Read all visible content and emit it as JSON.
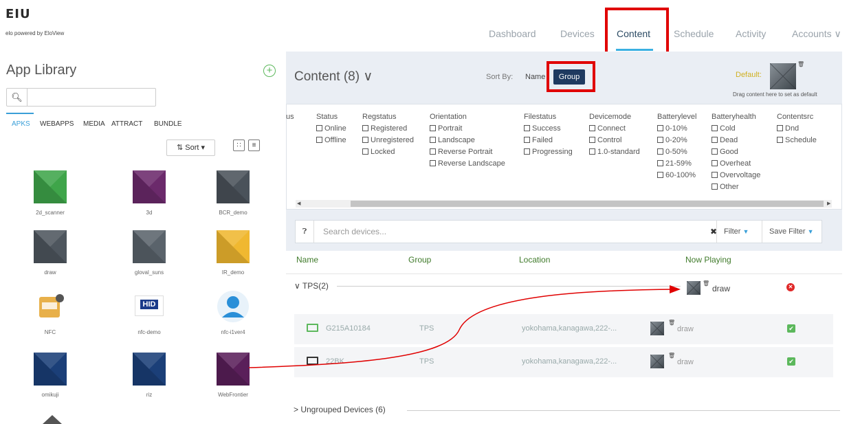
{
  "header": {
    "logo": "EIU",
    "powered_by": "elo powered by EloView",
    "nav": [
      "Dashboard",
      "Devices",
      "Content",
      "Schedule",
      "Activity",
      "Accounts ∨"
    ]
  },
  "library": {
    "title": "App Library",
    "search_placeholder": "",
    "tabs": [
      "APKS",
      "WEBAPPS",
      "MEDIA",
      "ATTRACT",
      "BUNDLE"
    ],
    "sort_label": "Sort",
    "apps": [
      {
        "name": "2d_scanner",
        "color": "#3fa54a"
      },
      {
        "name": "3d",
        "color": "#6b2a6b"
      },
      {
        "name": "BCR_demo",
        "color": "#4a525a"
      },
      {
        "name": "draw",
        "color": "#4e565e"
      },
      {
        "name": "gloval_suns",
        "color": "#5a636b"
      },
      {
        "name": "IR_demo",
        "color": "#f0b830"
      },
      {
        "name": "NFC",
        "color": "#e8b04a"
      },
      {
        "name": "nfc-demo",
        "color": "#1a3a8a"
      },
      {
        "name": "nfc-i1ver4",
        "color": "#2a8fd8"
      },
      {
        "name": "omikuji",
        "color": "#1b3f78"
      },
      {
        "name": "riz",
        "color": "#1b3f78"
      },
      {
        "name": "WebFrontier",
        "color": "#5a1f5a"
      }
    ],
    "hid_text": "HID"
  },
  "content": {
    "title": "Content (8) ∨",
    "sort_by": "Sort By:",
    "sort_name": "Name",
    "sort_group": "Group",
    "default_label": "Default:",
    "default_hint": "Drag content here to set as default",
    "filters": [
      {
        "title": "us",
        "options": []
      },
      {
        "title": "Status",
        "options": [
          "Online",
          "Offline"
        ]
      },
      {
        "title": "Regstatus",
        "options": [
          "Registered",
          "Unregistered",
          "Locked"
        ]
      },
      {
        "title": "Orientation",
        "options": [
          "Portrait",
          "Landscape",
          "Reverse Portrait",
          "Reverse Landscape"
        ]
      },
      {
        "title": "Filestatus",
        "options": [
          "Success",
          "Failed",
          "Progressing"
        ]
      },
      {
        "title": "Devicemode",
        "options": [
          "Connect",
          "Control",
          "1.0-standard"
        ]
      },
      {
        "title": "Batterylevel",
        "options": [
          "0-10%",
          "0-20%",
          "0-50%",
          "21-59%",
          "60-100%"
        ]
      },
      {
        "title": "Batteryhealth",
        "options": [
          "Cold",
          "Dead",
          "Good",
          "Overheat",
          "Overvoltage",
          "Other"
        ]
      },
      {
        "title": "Contentsrc",
        "options": [
          "Dnd",
          "Schedule"
        ]
      }
    ],
    "search_placeholder": "Search devices...",
    "filter_btn": "Filter",
    "save_filter_btn": "Save Filter",
    "columns": [
      "Name",
      "Group",
      "Location",
      "Now Playing"
    ],
    "group": {
      "label": "∨ TPS(2)",
      "now_playing": "draw"
    },
    "devices": [
      {
        "name": "G215A10184",
        "group": "TPS",
        "location": "yokohama,kanagawa,222-...",
        "playing": "draw",
        "icon_color": "#5cb85c"
      },
      {
        "name": "22BK",
        "group": "TPS",
        "location": "yokohama,kanagawa,222-...",
        "playing": "draw",
        "icon_color": "#333333"
      }
    ],
    "ungrouped": "> Ungrouped Devices (6)"
  }
}
